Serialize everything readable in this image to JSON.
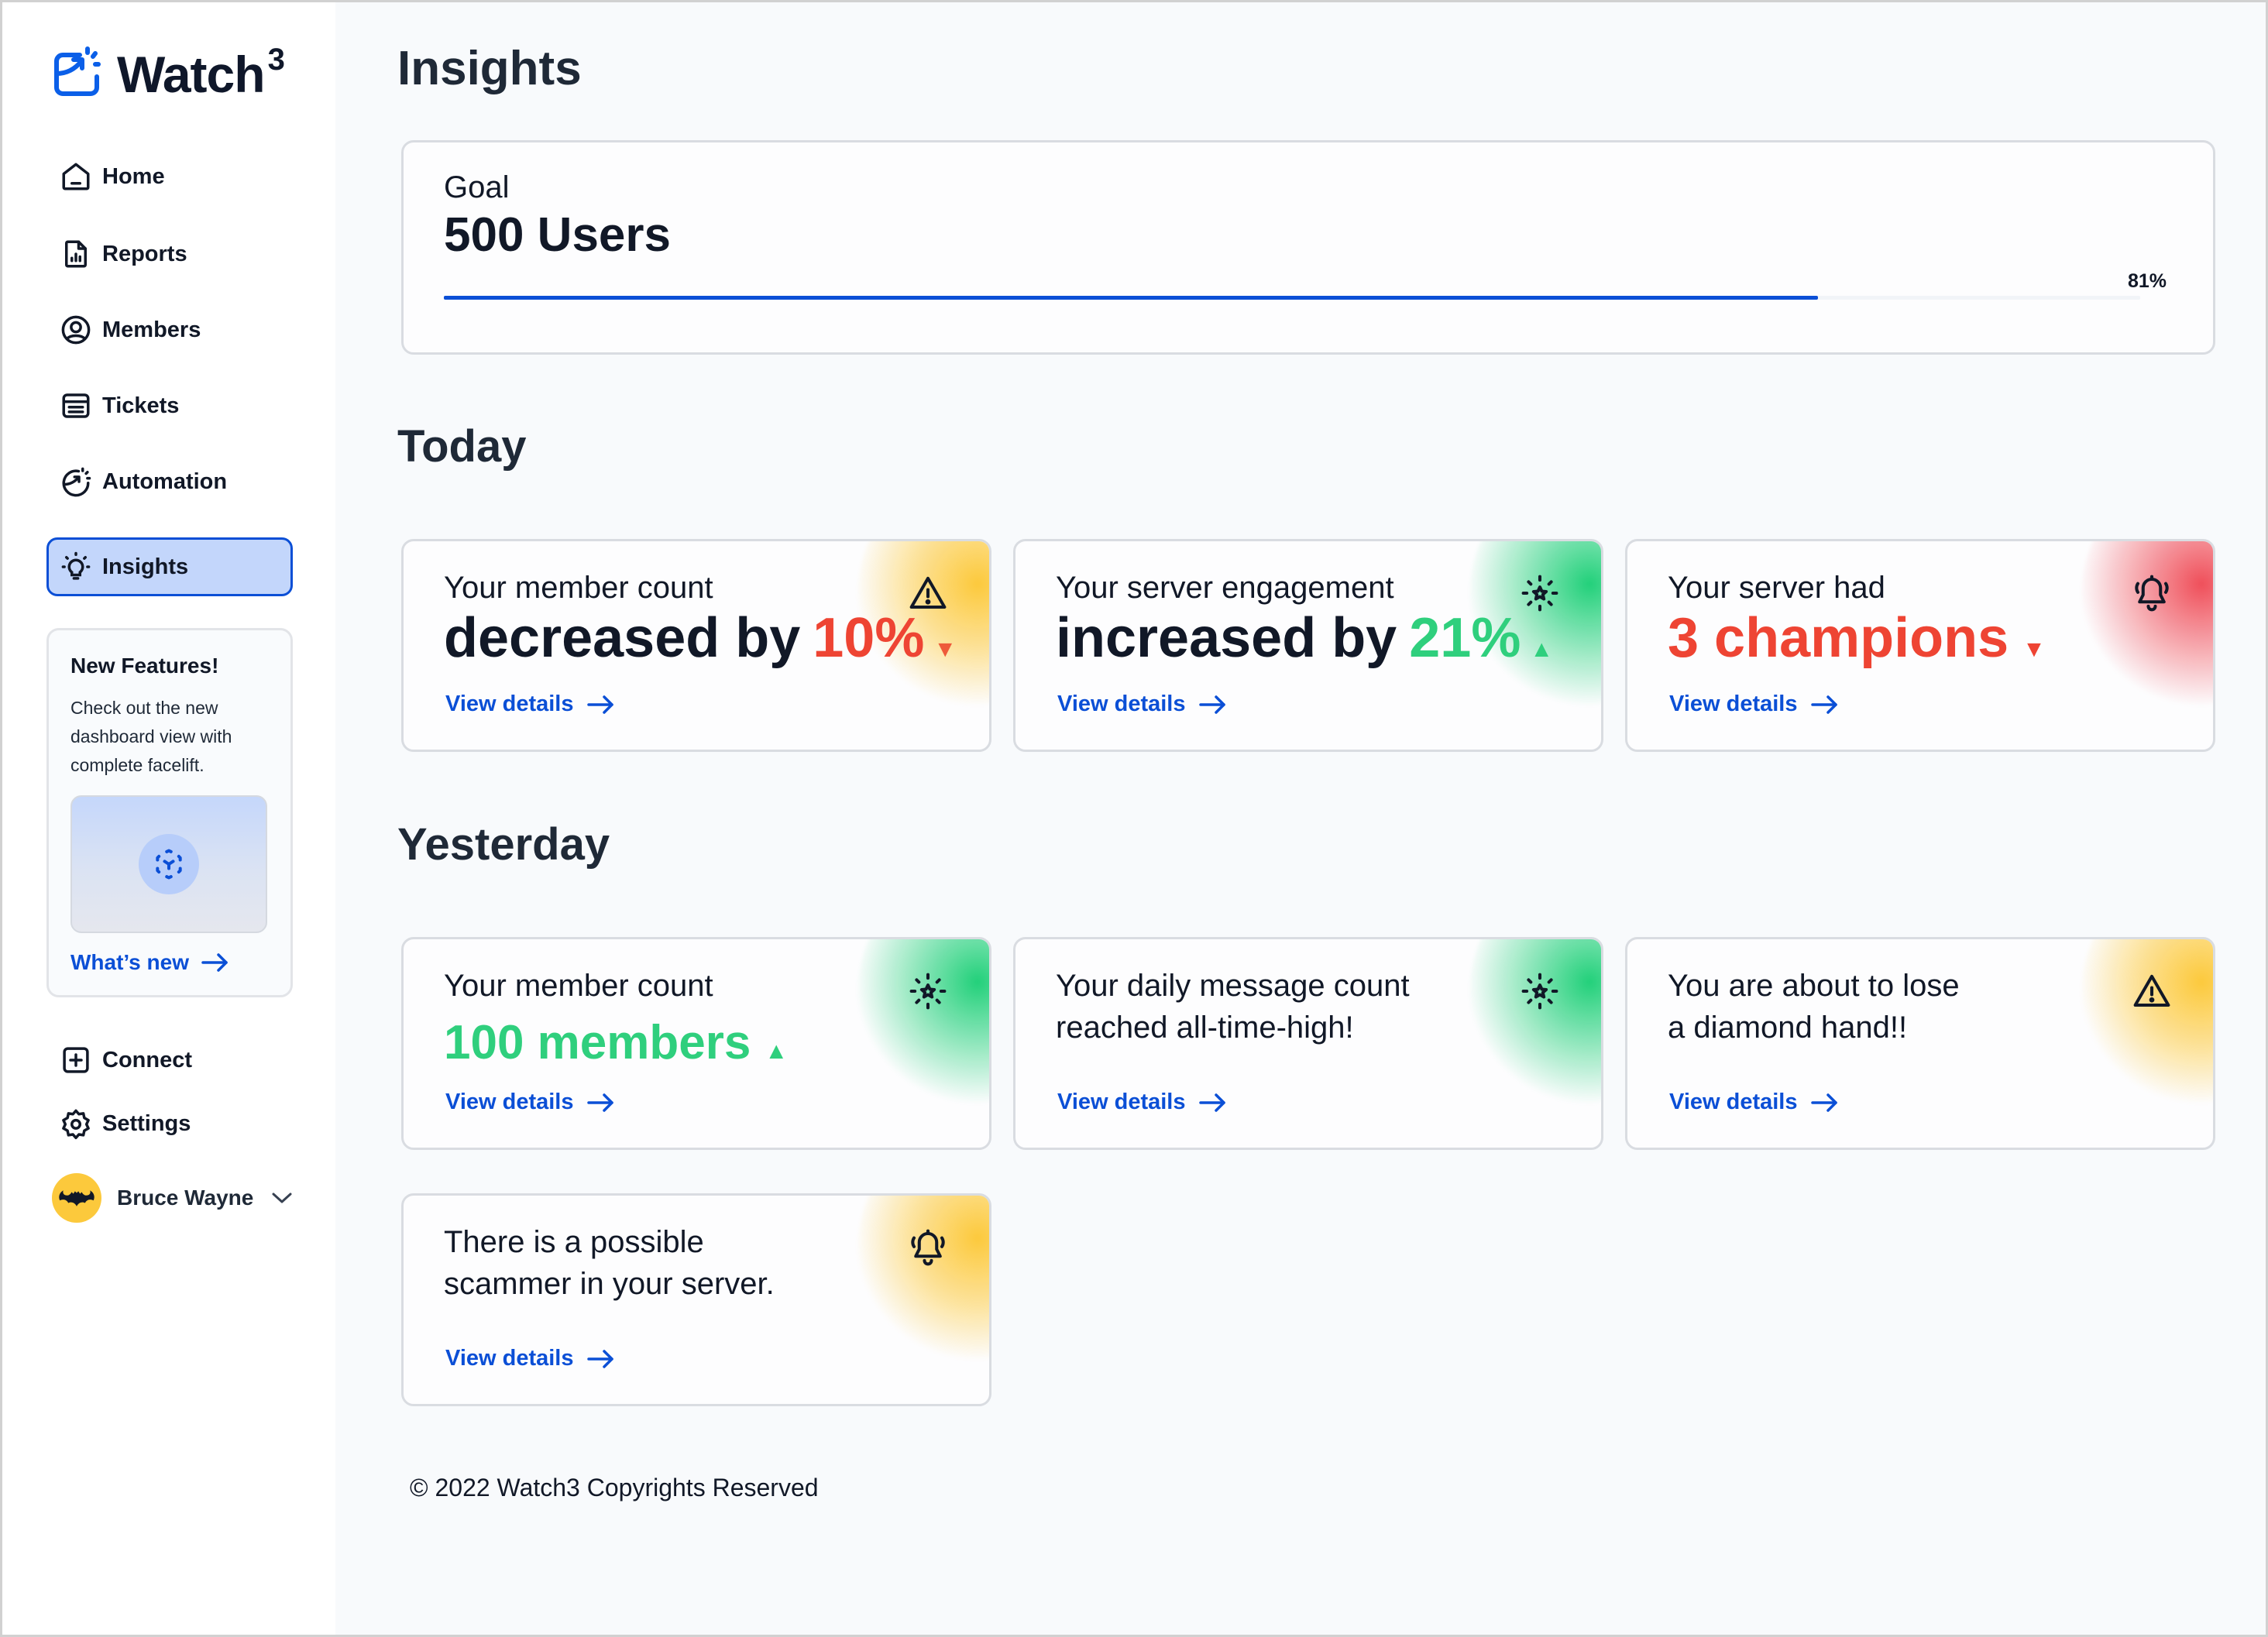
{
  "app": {
    "name": "Watch",
    "name_superscript": "3"
  },
  "sidebar": {
    "nav": [
      {
        "label": "Home",
        "icon": "home-icon"
      },
      {
        "label": "Reports",
        "icon": "report-icon"
      },
      {
        "label": "Members",
        "icon": "user-circle-icon"
      },
      {
        "label": "Tickets",
        "icon": "ticket-icon"
      },
      {
        "label": "Automation",
        "icon": "automation-icon"
      },
      {
        "label": "Insights",
        "icon": "lightbulb-icon",
        "active": true
      }
    ],
    "feature_card": {
      "title": "New Features!",
      "description": "Check out the new dashboard view with complete facelift.",
      "link_label": "What’s new",
      "media_icon": "cube-scan-icon"
    },
    "bottom_nav": [
      {
        "label": "Connect",
        "icon": "plus-square-icon"
      },
      {
        "label": "Settings",
        "icon": "gear-icon"
      }
    ],
    "user": {
      "name": "Bruce Wayne",
      "avatar": "bat-logo-avatar"
    }
  },
  "main": {
    "title": "Insights",
    "goal": {
      "label": "Goal",
      "value": "500 Users",
      "progress_percent": 81,
      "progress_label": "81%"
    },
    "sections": [
      {
        "title": "Today",
        "cards": [
          {
            "line1": "Your member count",
            "big_prefix": "decreased by",
            "big_accent": "10%",
            "trend": "down",
            "tone": "yellow",
            "icon": "warning-icon",
            "link": "View details"
          },
          {
            "line1": "Your server engagement",
            "big_prefix": "increased by",
            "big_accent": "21%",
            "trend": "up",
            "tone": "green",
            "icon": "sparkle-star-icon",
            "link": "View details"
          },
          {
            "line1": "Your server had",
            "big_prefix": "",
            "big_accent": "3 champions",
            "trend": "down",
            "tone": "red",
            "icon": "bell-ring-icon",
            "link": "View details"
          }
        ]
      },
      {
        "title": "Yesterday",
        "cards": [
          {
            "line1": "Your member count",
            "big_prefix": "",
            "big_accent": "100 members",
            "trend": "up",
            "tone": "green",
            "icon": "sparkle-star-icon",
            "link": "View details"
          },
          {
            "line1": "Your daily message count",
            "line2": "reached all-time-high!",
            "tone": "green",
            "icon": "sparkle-star-icon",
            "link": "View details"
          },
          {
            "line1": "You are about to lose",
            "line2": "a diamond hand!!",
            "tone": "yellow",
            "icon": "warning-icon",
            "link": "View details"
          },
          {
            "line1": "There is a possible",
            "line2": "scammer in your server.",
            "tone": "yellow",
            "icon": "bell-ring-icon",
            "link": "View details"
          }
        ]
      }
    ],
    "footer": "© 2022 Watch3 Copyrights Reserved"
  },
  "colors": {
    "brand_blue": "#0b4fd6",
    "active_bg": "#c3d6fb",
    "negative": "#ee4433",
    "positive": "#2fcf7d",
    "warning_glow": "#fcc93c",
    "success_glow": "#22d07a",
    "alert_glow": "#ef4f5a"
  }
}
